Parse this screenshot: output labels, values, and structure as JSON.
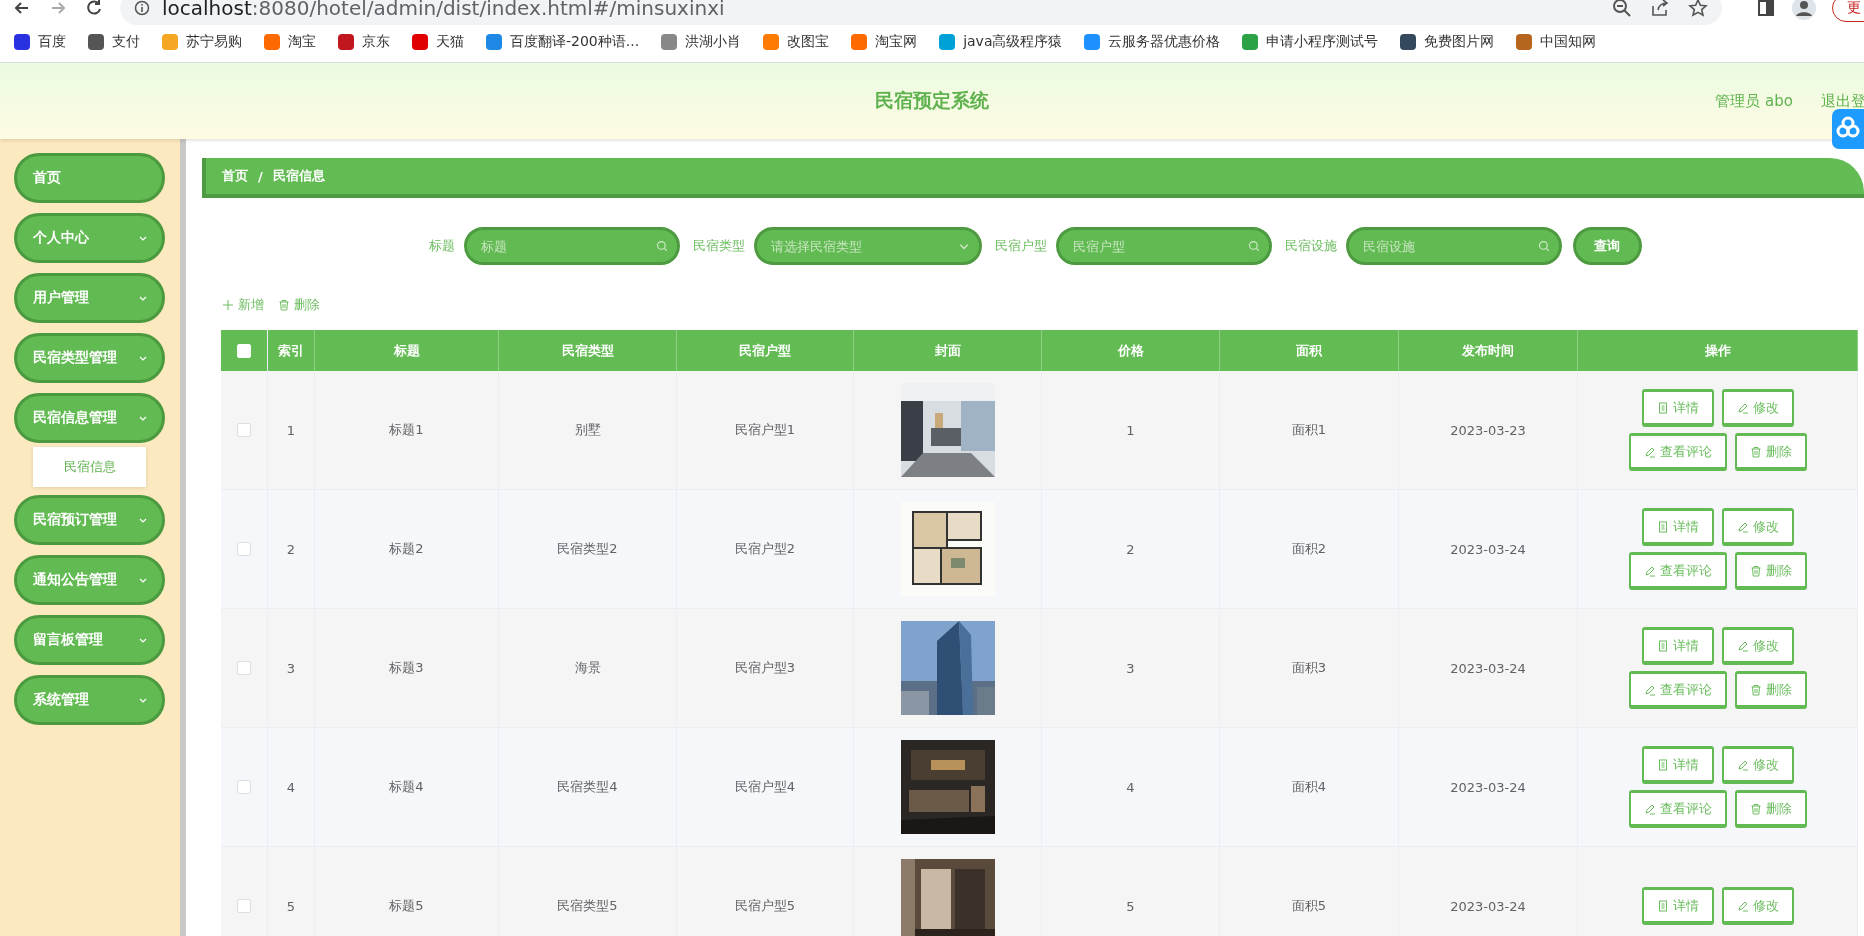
{
  "browser": {
    "url_host": "localhost",
    "url_path": ":8080/hotel/admin/dist/index.html#/minsuxinxi",
    "update_button": "更",
    "bookmarks": [
      {
        "label": "百度",
        "color": "#2932e1"
      },
      {
        "label": "支付",
        "color": "#555555"
      },
      {
        "label": "苏宁易购",
        "color": "#f5a623"
      },
      {
        "label": "淘宝",
        "color": "#ff6a00"
      },
      {
        "label": "京东",
        "color": "#c0161d"
      },
      {
        "label": "天猫",
        "color": "#e00000"
      },
      {
        "label": "百度翻译-200种语...",
        "color": "#1e88e5"
      },
      {
        "label": "洪湖小肖",
        "color": "#888888"
      },
      {
        "label": "改图宝",
        "color": "#ff7a00"
      },
      {
        "label": "淘宝网",
        "color": "#ff6a00"
      },
      {
        "label": "java高级程序猿",
        "color": "#00a1d6"
      },
      {
        "label": "云服务器优惠价格",
        "color": "#1e90ff"
      },
      {
        "label": "申请小程序测试号",
        "color": "#2ba245"
      },
      {
        "label": "免费图片网",
        "color": "#34495e"
      },
      {
        "label": "中国知网",
        "color": "#b5651d"
      }
    ]
  },
  "header": {
    "title": "民宿预定系统",
    "user": "管理员 abo",
    "logout": "退出登"
  },
  "sidebar": {
    "items": [
      {
        "label": "首页",
        "expandable": false
      },
      {
        "label": "个人中心",
        "expandable": true
      },
      {
        "label": "用户管理",
        "expandable": true
      },
      {
        "label": "民宿类型管理",
        "expandable": true
      },
      {
        "label": "民宿信息管理",
        "expandable": true,
        "children": [
          {
            "label": "民宿信息",
            "selected": true
          }
        ]
      },
      {
        "label": "民宿预订管理",
        "expandable": true
      },
      {
        "label": "通知公告管理",
        "expandable": true
      },
      {
        "label": "留言板管理",
        "expandable": true
      },
      {
        "label": "系统管理",
        "expandable": true
      }
    ]
  },
  "breadcrumb": {
    "items": [
      "首页",
      "民宿信息"
    ],
    "separator": "/"
  },
  "search": {
    "fields": [
      {
        "label": "标题",
        "placeholder": "标题",
        "kind": "input"
      },
      {
        "label": "民宿类型",
        "placeholder": "请选择民宿类型",
        "kind": "select"
      },
      {
        "label": "民宿户型",
        "placeholder": "民宿户型",
        "kind": "input"
      },
      {
        "label": "民宿设施",
        "placeholder": "民宿设施",
        "kind": "input"
      }
    ],
    "button": "查询"
  },
  "toolbar": [
    {
      "label": "新增",
      "kind": "add"
    },
    {
      "label": "删除",
      "kind": "delete"
    }
  ],
  "table": {
    "header_checked": false,
    "columns": [
      "索引",
      "标题",
      "民宿类型",
      "民宿户型",
      "封面",
      "价格",
      "面积",
      "发布时间",
      "操作"
    ],
    "rows": [
      {
        "checked": false,
        "cells": [
          "1",
          "标题1",
          "别墅",
          "民宿户型1"
        ],
        "cover": {
          "kind": "picture"
        },
        "cells_after": [
          "1",
          "面积1",
          "2023-03-23"
        ],
        "actions": [
          {
            "label": "详情",
            "kind": "detail"
          },
          {
            "label": "修改",
            "kind": "edit"
          },
          {
            "label": "查看评论",
            "kind": "edit"
          },
          {
            "label": "删除",
            "kind": "delete"
          }
        ]
      },
      {
        "checked": false,
        "cells": [
          "2",
          "标题2",
          "民宿类型2",
          "民宿户型2"
        ],
        "cover": {
          "kind": "picture"
        },
        "cells_after": [
          "2",
          "面积2",
          "2023-03-24"
        ],
        "actions": [
          {
            "label": "详情",
            "kind": "detail"
          },
          {
            "label": "修改",
            "kind": "edit"
          },
          {
            "label": "查看评论",
            "kind": "edit"
          },
          {
            "label": "删除",
            "kind": "delete"
          }
        ]
      },
      {
        "checked": false,
        "cells": [
          "3",
          "标题3",
          "海景",
          "民宿户型3"
        ],
        "cover": {
          "kind": "picture"
        },
        "cells_after": [
          "3",
          "面积3",
          "2023-03-24"
        ],
        "actions": [
          {
            "label": "详情",
            "kind": "detail"
          },
          {
            "label": "修改",
            "kind": "edit"
          },
          {
            "label": "查看评论",
            "kind": "edit"
          },
          {
            "label": "删除",
            "kind": "delete"
          }
        ]
      },
      {
        "checked": false,
        "cells": [
          "4",
          "标题4",
          "民宿类型4",
          "民宿户型4"
        ],
        "cover": {
          "kind": "picture"
        },
        "cells_after": [
          "4",
          "面积4",
          "2023-03-24"
        ],
        "actions": [
          {
            "label": "详情",
            "kind": "detail"
          },
          {
            "label": "修改",
            "kind": "edit"
          },
          {
            "label": "查看评论",
            "kind": "edit"
          },
          {
            "label": "删除",
            "kind": "delete"
          }
        ]
      },
      {
        "checked": false,
        "cells": [
          "5",
          "标题5",
          "民宿类型5",
          "民宿户型5"
        ],
        "cover": {
          "kind": "picture"
        },
        "cells_after": [
          "5",
          "面积5",
          "2023-03-24"
        ],
        "actions": [
          {
            "label": "详情",
            "kind": "detail"
          },
          {
            "label": "修改",
            "kind": "edit"
          }
        ]
      }
    ]
  }
}
